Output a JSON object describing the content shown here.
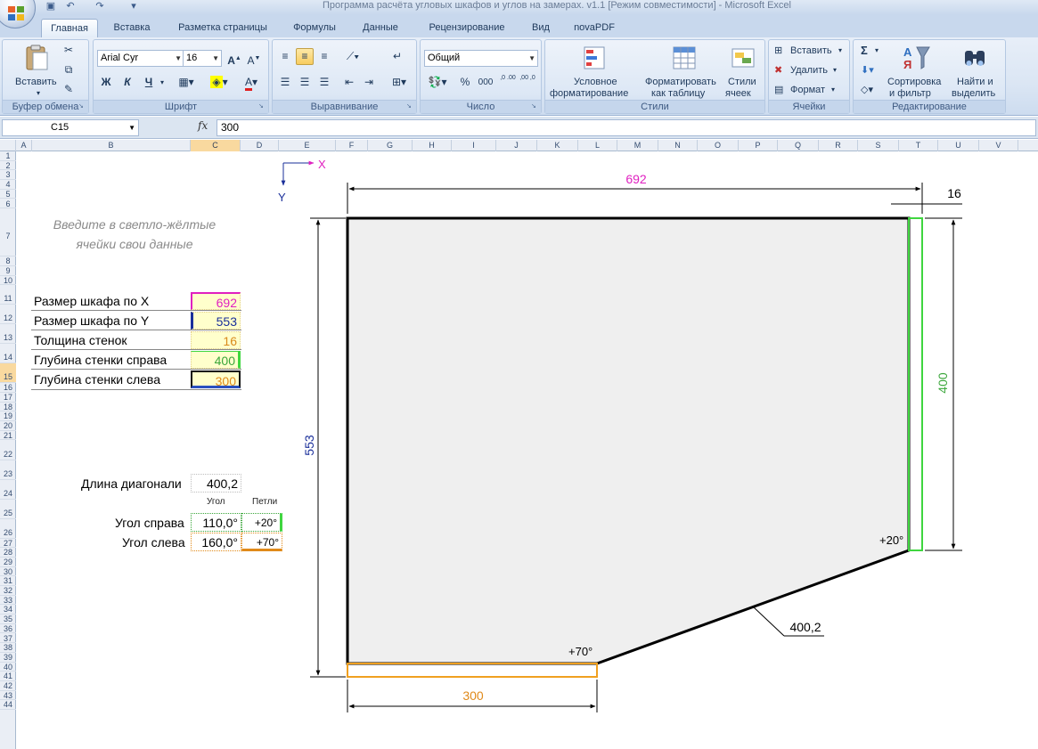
{
  "window": {
    "title": "Программа расчёта угловых шкафов и углов на замерах. v1.1   [Режим совместимости] - Microsoft Excel"
  },
  "tabs": [
    "Главная",
    "Вставка",
    "Разметка страницы",
    "Формулы",
    "Данные",
    "Рецензирование",
    "Вид",
    "novaPDF"
  ],
  "active_tab": "Главная",
  "ribbon": {
    "clipboard": {
      "paste": "Вставить",
      "label": "Буфер обмена"
    },
    "font": {
      "name": "Arial Cyr",
      "size": "16",
      "bold": "Ж",
      "italic": "К",
      "underline": "Ч",
      "label": "Шрифт"
    },
    "alignment": {
      "label": "Выравнивание"
    },
    "number": {
      "format": "Общий",
      "percent": "%",
      "thousands": "000",
      "inc_dec": ",0 .00",
      "dec_dec": ",00 ,0",
      "label": "Число"
    },
    "styles": {
      "conditional_1": "Условное",
      "conditional_2": "форматирование",
      "table_1": "Форматировать",
      "table_2": "как таблицу",
      "cell_1": "Стили",
      "cell_2": "ячеек",
      "label": "Стили"
    },
    "cells": {
      "insert": "Вставить",
      "delete": "Удалить",
      "format": "Формат",
      "label": "Ячейки"
    },
    "editing": {
      "sum": "Σ",
      "sort_1": "Сортировка",
      "sort_2": "и фильтр",
      "find_1": "Найти и",
      "find_2": "выделить",
      "label": "Редактирование"
    }
  },
  "formula_bar": {
    "name_box": "C15",
    "fx": "fx",
    "value": "300"
  },
  "columns": [
    "A",
    "B",
    "C",
    "D",
    "E",
    "F",
    "G",
    "H",
    "I",
    "J",
    "K",
    "L",
    "M",
    "N",
    "O",
    "P",
    "Q",
    "R",
    "S",
    "T",
    "U",
    "V"
  ],
  "selected_column": "C",
  "rows": [
    "1",
    "2",
    "3",
    "4",
    "5",
    "6",
    "7",
    "8",
    "9",
    "10",
    "11",
    "12",
    "13",
    "14",
    "15",
    "16",
    "17",
    "18",
    "19",
    "20",
    "21",
    "22",
    "23",
    "24",
    "25",
    "26",
    "27",
    "28",
    "29",
    "30",
    "31",
    "32",
    "33",
    "34",
    "35",
    "36",
    "37",
    "38",
    "39",
    "40",
    "41",
    "42",
    "43",
    "44"
  ],
  "selected_row": "15",
  "sheet": {
    "hint_line1": "Введите в светло-жёлтые",
    "hint_line2": "ячейки свои данные",
    "inputs": [
      {
        "label": "Размер шкафа по X",
        "value": "692",
        "color": "#e020c0"
      },
      {
        "label": "Размер шкафа по Y",
        "value": "553",
        "color": "#1a2f9a"
      },
      {
        "label": "Толщина стенок",
        "value": "16",
        "color": "#d98a1c"
      },
      {
        "label": "Глубина  стенки справа",
        "value": "400",
        "color": "#3aa63a"
      },
      {
        "label": "Глубина  стенки слева",
        "value": "300",
        "color": "#e08a1a"
      }
    ],
    "diagonal_label": "Длина диагонали",
    "diagonal_value": "400,2",
    "head_angle": "Угол",
    "head_hinges": "Петли",
    "angle_right_label": "Угол справа",
    "angle_right_value": "110,0°",
    "hinge_right": "+20°",
    "angle_left_label": "Угол слева",
    "angle_left_value": "160,0°",
    "hinge_left": "+70°"
  },
  "drawing": {
    "axis_x": "X",
    "axis_y": "Y",
    "dim_top": "692",
    "dim_thickness": "16",
    "dim_left": "553",
    "dim_right": "400",
    "dim_bottom": "300",
    "dim_diagonal": "400,2",
    "angle_right": "+20°",
    "angle_left": "+70°",
    "colors": {
      "x": "#e020c0",
      "y": "#1a2f9a",
      "right": "#3aa63a",
      "left": "#e08a1a",
      "fill": "#efefef"
    }
  }
}
